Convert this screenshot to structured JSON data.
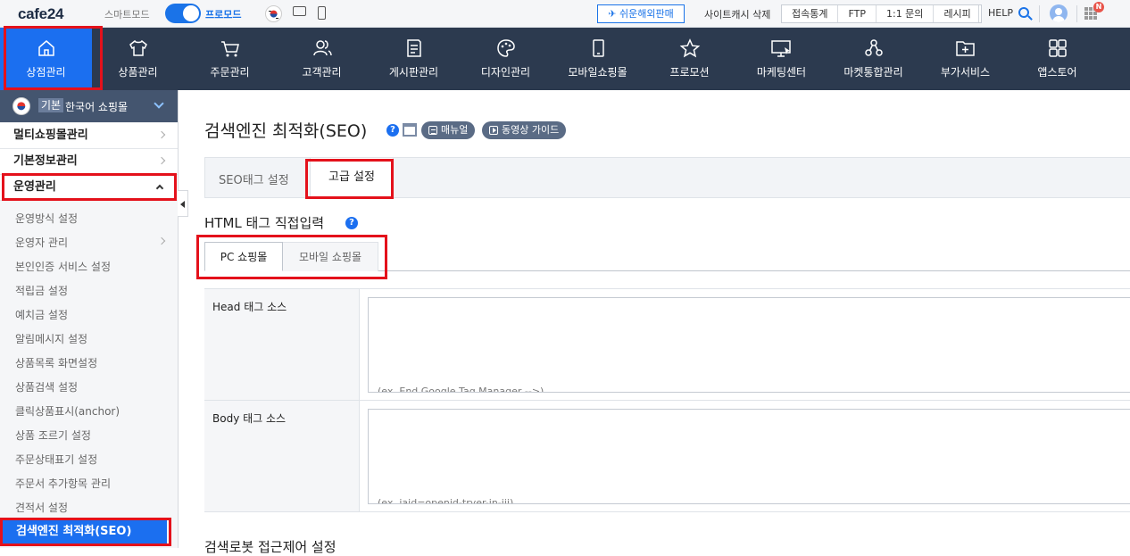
{
  "topbar": {
    "logo": "cafe24",
    "mode_left": "스마트모드",
    "mode_right": "프로모드",
    "easy_button": "✈ 쉬운해외판매",
    "cache_delete": "사이트캐시 삭제",
    "links": [
      "접속통계",
      "FTP",
      "1:1 문의",
      "레시피"
    ],
    "help": "HELP",
    "notification_badge": "N"
  },
  "mainnav": {
    "items": [
      {
        "label": "상점관리",
        "icon": "home-icon"
      },
      {
        "label": "상품관리",
        "icon": "shirt-icon"
      },
      {
        "label": "주문관리",
        "icon": "cart-icon"
      },
      {
        "label": "고객관리",
        "icon": "users-icon"
      },
      {
        "label": "게시판관리",
        "icon": "board-icon"
      },
      {
        "label": "디자인관리",
        "icon": "palette-icon"
      },
      {
        "label": "모바일쇼핑몰",
        "icon": "mobile-icon"
      },
      {
        "label": "프로모션",
        "icon": "star-icon"
      },
      {
        "label": "마케팅센터",
        "icon": "monitor-icon"
      },
      {
        "label": "마켓통합관리",
        "icon": "network-icon"
      },
      {
        "label": "부가서비스",
        "icon": "folder-plus-icon"
      },
      {
        "label": "앱스토어",
        "icon": "apps-icon"
      }
    ],
    "active_index": 0
  },
  "sidebar": {
    "shop_badge": "기본",
    "shop_name": "한국어 쇼핑몰",
    "menus": [
      "멀티쇼핑몰관리",
      "기본정보관리",
      "운영관리"
    ],
    "submenu": [
      "운영방식 설정",
      "운영자 관리",
      "본인인증 서비스 설정",
      "적립금 설정",
      "예치금 설정",
      "알림메시지 설정",
      "상품목록 화면설정",
      "상품검색 설정",
      "클릭상품표시(anchor)",
      "상품 조르기 설정",
      "주문상태표기 설정",
      "주문서 추가항목 관리",
      "견적서 설정"
    ],
    "active_item": "검색엔진 최적화(SEO)"
  },
  "content": {
    "title": "검색엔진 최적화(SEO)",
    "help": "?",
    "manual_button": "매뉴얼",
    "video_button": "동영상 가이드",
    "tabs": [
      "SEO태그 설정",
      "고급 설정"
    ],
    "section_title": "HTML 태그 직접입력",
    "subtabs": [
      "PC 쇼핑몰",
      "모바일 쇼핑몰"
    ],
    "fields": [
      {
        "label": "Head 태그 소스",
        "value": "(ex. End Google Tag Manager -->)"
      },
      {
        "label": "Body 태그 소스",
        "value": "(ex. iaid=openid-tryer-in-iii)"
      }
    ],
    "next_section_title": "검색로봇 접근제어 설정"
  },
  "colors": {
    "nav_bg": "#2c3a4f",
    "accent": "#1b6ff0",
    "highlight": "#e4111b"
  }
}
